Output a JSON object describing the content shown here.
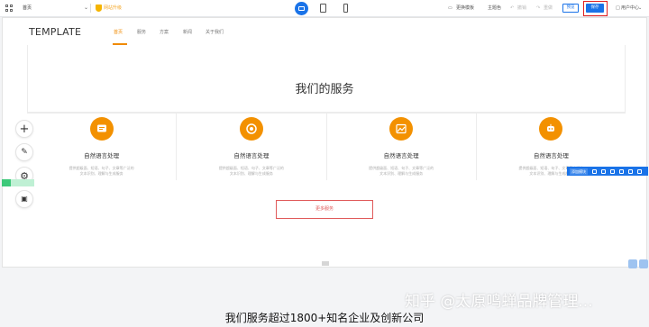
{
  "toolbar": {
    "page_select": "首页",
    "upgrade_label": "网站升级",
    "replace_template": "更换模板",
    "theme_color": "主题色",
    "undo": "撤销",
    "redo": "重做",
    "preview": "预览",
    "save": "保存",
    "user_center": "用户中心"
  },
  "site": {
    "logo": "TEMPLATE",
    "nav": [
      "首页",
      "服务",
      "方案",
      "新闻",
      "关于我们"
    ]
  },
  "section": {
    "title": "我们的服务",
    "more_button": "更多服务"
  },
  "cards": [
    {
      "title": "自然语言处理",
      "desc": "提供超级面、短语、句子、文章等广泛的文本识别、理解与生成服务",
      "icon": "chat-icon"
    },
    {
      "title": "自然语言处理",
      "desc": "提供超级面、短语、句子、文章等广泛的文本识别、理解与生成服务",
      "icon": "target-icon"
    },
    {
      "title": "自然语言处理",
      "desc": "提供超级面、短语、句子、文章等广泛的文本识别、理解与生成服务",
      "icon": "image-icon"
    },
    {
      "title": "自然语言处理",
      "desc": "提供超级面、短语、句子、文章等广泛的文本识别、理解与生成服务",
      "icon": "robot-icon"
    }
  ],
  "float_bar": {
    "label": "添加模块"
  },
  "watermark": "知乎 @太原鸣蝉品牌管理...",
  "subtitle": "我们服务超过1800+知名企业及创新公司",
  "colors": {
    "accent": "#f39100",
    "primary": "#1a73e8",
    "highlight": "#e02020"
  }
}
